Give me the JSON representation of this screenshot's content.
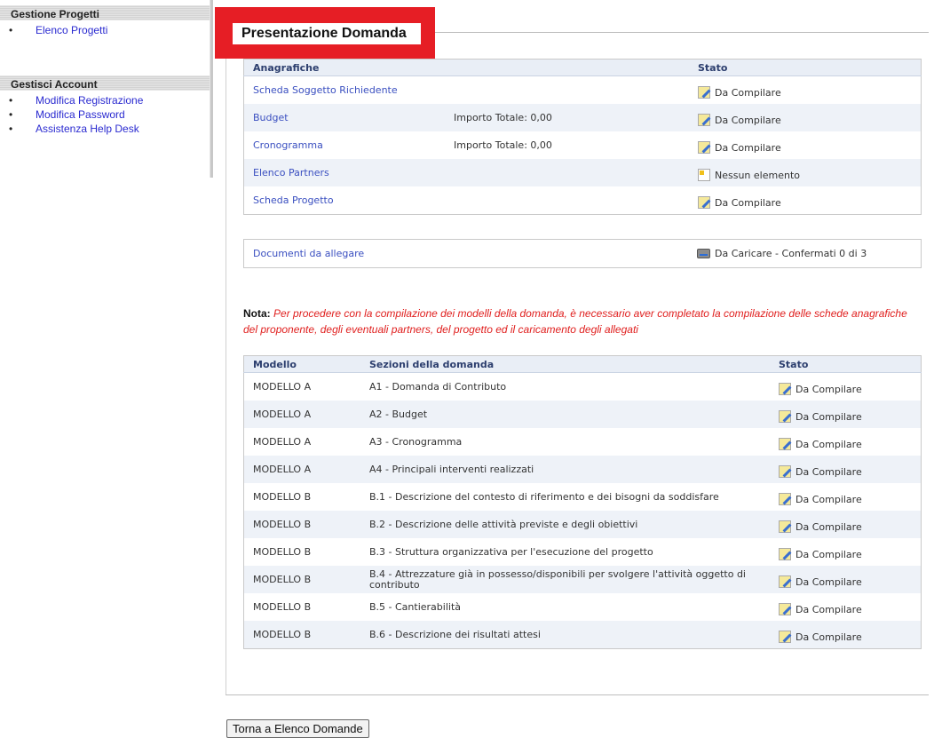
{
  "sidebar": {
    "progetti": {
      "header": "Gestione Progetti",
      "items": [
        {
          "label": "Elenco Progetti"
        }
      ]
    },
    "account": {
      "header": "Gestisci Account",
      "items": [
        {
          "label": "Modifica Registrazione"
        },
        {
          "label": "Modifica Password"
        },
        {
          "label": "Assistenza Help Desk"
        }
      ]
    }
  },
  "main": {
    "title": "Presentazione Domanda",
    "anagrafiche": {
      "col_name": "Anagrafiche",
      "col_stato": "Stato",
      "rows": [
        {
          "name": "Scheda Soggetto Richiedente",
          "importo": "",
          "stato": "Da Compilare",
          "icon": "pencil-icon"
        },
        {
          "name": "Budget",
          "importo": "Importo Totale: 0,00",
          "stato": "Da Compilare",
          "icon": "pencil-icon"
        },
        {
          "name": "Cronogramma",
          "importo": "Importo Totale: 0,00",
          "stato": "Da Compilare",
          "icon": "pencil-icon"
        },
        {
          "name": "Elenco Partners",
          "importo": "",
          "stato": "Nessun elemento",
          "icon": "document-icon"
        },
        {
          "name": "Scheda Progetto",
          "importo": "",
          "stato": "Da Compilare",
          "icon": "pencil-icon"
        }
      ]
    },
    "documenti": {
      "name": "Documenti da allegare",
      "stato": "Da Caricare - Confermati 0 di 3",
      "icon": "drive-icon"
    },
    "nota": {
      "label": "Nota:",
      "text": "Per procedere con la compilazione dei modelli della domanda, è necessario aver completato la compilazione delle schede anagrafiche del proponente, degli eventuali partners, del progetto ed il caricamento degli allegati"
    },
    "modelli": {
      "col_modello": "Modello",
      "col_sezioni": "Sezioni della domanda",
      "col_stato": "Stato",
      "rows": [
        {
          "modello": "MODELLO A",
          "sezione": "A1 - Domanda di Contributo",
          "stato": "Da Compilare"
        },
        {
          "modello": "MODELLO A",
          "sezione": "A2 - Budget",
          "stato": "Da Compilare"
        },
        {
          "modello": "MODELLO A",
          "sezione": "A3 - Cronogramma",
          "stato": "Da Compilare"
        },
        {
          "modello": "MODELLO A",
          "sezione": "A4 - Principali interventi realizzati",
          "stato": "Da Compilare"
        },
        {
          "modello": "MODELLO B",
          "sezione": "B.1 - Descrizione del contesto di riferimento e dei bisogni da soddisfare",
          "stato": "Da Compilare"
        },
        {
          "modello": "MODELLO B",
          "sezione": "B.2 - Descrizione delle attività previste e degli obiettivi",
          "stato": "Da Compilare"
        },
        {
          "modello": "MODELLO B",
          "sezione": "B.3 - Struttura organizzativa per l'esecuzione del progetto",
          "stato": "Da Compilare"
        },
        {
          "modello": "MODELLO B",
          "sezione": "B.4 - Attrezzature già in possesso/disponibili per svolgere l'attività oggetto di contributo",
          "stato": "Da Compilare"
        },
        {
          "modello": "MODELLO B",
          "sezione": "B.5 - Cantierabilità",
          "stato": "Da Compilare"
        },
        {
          "modello": "MODELLO B",
          "sezione": "B.6 - Descrizione dei risultati attesi",
          "stato": "Da Compilare"
        }
      ]
    },
    "back_button": "Torna a Elenco Domande"
  },
  "colors": {
    "highlight": "#e61e25",
    "link": "#3a4fc0",
    "nota_text": "#e0201f",
    "table_header_bg": "#e9eef6",
    "table_alt_row": "#eef2f8"
  }
}
